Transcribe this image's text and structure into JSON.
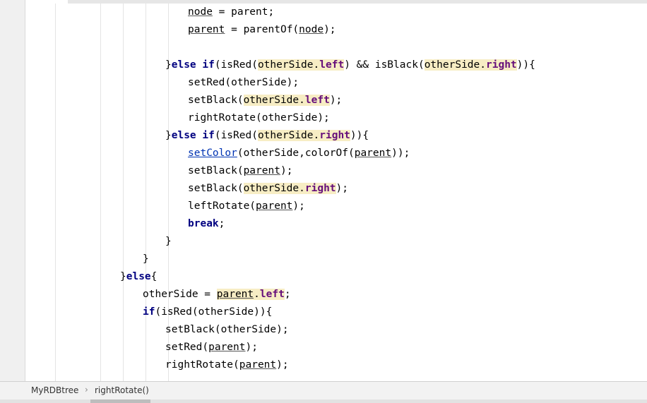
{
  "editor": {
    "lines": [
      {
        "indent": 230,
        "tokens": [
          {
            "t": "node",
            "c": "u"
          },
          {
            "t": " = parent;"
          }
        ]
      },
      {
        "indent": 230,
        "tokens": [
          {
            "t": "parent",
            "c": "u"
          },
          {
            "t": " = parentOf("
          },
          {
            "t": "node",
            "c": "u"
          },
          {
            "t": ");"
          }
        ]
      },
      {
        "indent": 230,
        "tokens": []
      },
      {
        "indent": 198,
        "tokens": [
          {
            "t": "}"
          },
          {
            "t": "else if",
            "c": "kw"
          },
          {
            "t": "(isRed("
          },
          {
            "t": "otherSide.",
            "c": "hl"
          },
          {
            "t": "left",
            "c": "hl fld"
          },
          {
            "t": ") && isBlack("
          },
          {
            "t": "otherSide.",
            "c": "hl"
          },
          {
            "t": "right",
            "c": "hl fld"
          },
          {
            "t": ")){"
          }
        ]
      },
      {
        "indent": 230,
        "tokens": [
          {
            "t": "setRed(otherSide);"
          }
        ]
      },
      {
        "indent": 230,
        "tokens": [
          {
            "t": "setBlack("
          },
          {
            "t": "otherSide.",
            "c": "hl"
          },
          {
            "t": "left",
            "c": "hl fld"
          },
          {
            "t": ");"
          }
        ]
      },
      {
        "indent": 230,
        "tokens": [
          {
            "t": "rightRotate(otherSide);"
          }
        ]
      },
      {
        "indent": 198,
        "tokens": [
          {
            "t": "}"
          },
          {
            "t": "else if",
            "c": "kw"
          },
          {
            "t": "(isRed("
          },
          {
            "t": "otherSide.",
            "c": "hl"
          },
          {
            "t": "right",
            "c": "hl fld"
          },
          {
            "t": ")){"
          }
        ]
      },
      {
        "indent": 230,
        "tokens": [
          {
            "t": "setColor",
            "c": "link"
          },
          {
            "t": "(otherSide,colorOf("
          },
          {
            "t": "parent",
            "c": "u"
          },
          {
            "t": "));"
          }
        ]
      },
      {
        "indent": 230,
        "tokens": [
          {
            "t": "setBlack("
          },
          {
            "t": "parent",
            "c": "u"
          },
          {
            "t": ");"
          }
        ]
      },
      {
        "indent": 230,
        "tokens": [
          {
            "t": "setBlack("
          },
          {
            "t": "otherSide.",
            "c": "hl"
          },
          {
            "t": "right",
            "c": "hl fld"
          },
          {
            "t": ");"
          }
        ]
      },
      {
        "indent": 230,
        "tokens": [
          {
            "t": "leftRotate("
          },
          {
            "t": "parent",
            "c": "u"
          },
          {
            "t": ");"
          }
        ]
      },
      {
        "indent": 230,
        "tokens": [
          {
            "t": "break",
            "c": "kw"
          },
          {
            "t": ";"
          }
        ]
      },
      {
        "indent": 198,
        "tokens": [
          {
            "t": "}"
          }
        ]
      },
      {
        "indent": 166,
        "tokens": [
          {
            "t": "}"
          }
        ]
      },
      {
        "indent": 134,
        "tokens": [
          {
            "t": "}"
          },
          {
            "t": "else",
            "c": "kw"
          },
          {
            "t": "{"
          }
        ]
      },
      {
        "indent": 166,
        "tokens": [
          {
            "t": "otherSide = "
          },
          {
            "t": "parent",
            "c": "hl u"
          },
          {
            "t": ".",
            "c": "hl"
          },
          {
            "t": "left",
            "c": "hl fld"
          },
          {
            "t": ";"
          }
        ]
      },
      {
        "indent": 166,
        "tokens": [
          {
            "t": "if",
            "c": "kw"
          },
          {
            "t": "(isRed(otherSide)){"
          }
        ]
      },
      {
        "indent": 198,
        "tokens": [
          {
            "t": "setBlack(otherSide);"
          }
        ]
      },
      {
        "indent": 198,
        "tokens": [
          {
            "t": "setRed("
          },
          {
            "t": "parent",
            "c": "u"
          },
          {
            "t": ");"
          }
        ]
      },
      {
        "indent": 198,
        "tokens": [
          {
            "t": "rightRotate("
          },
          {
            "t": "parent",
            "c": "u"
          },
          {
            "t": ");"
          }
        ]
      }
    ]
  },
  "breadcrumb": {
    "class_name": "MyRDBtree",
    "separator": "›",
    "method_name": "rightRotate()"
  }
}
